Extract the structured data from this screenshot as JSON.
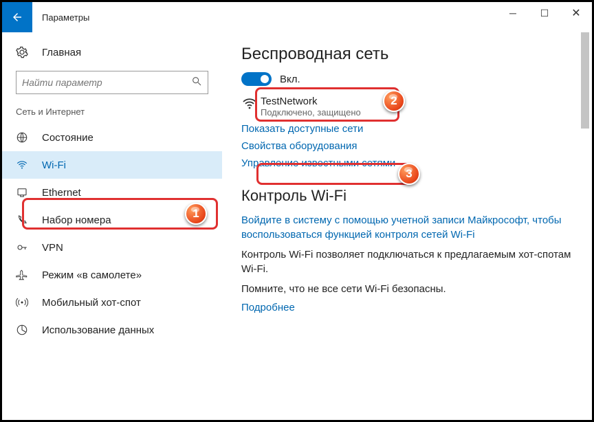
{
  "titlebar": {
    "title": "Параметры"
  },
  "sidebar": {
    "home": "Главная",
    "search_placeholder": "Найти параметр",
    "section": "Сеть и Интернет",
    "items": [
      {
        "label": "Состояние"
      },
      {
        "label": "Wi-Fi"
      },
      {
        "label": "Ethernet"
      },
      {
        "label": "Набор номера"
      },
      {
        "label": "VPN"
      },
      {
        "label": "Режим «в самолете»"
      },
      {
        "label": "Мобильный хот-спот"
      },
      {
        "label": "Использование данных"
      }
    ]
  },
  "content": {
    "heading1": "Беспроводная сеть",
    "toggle_label": "Вкл.",
    "network": {
      "name": "TestNetwork",
      "status": "Подключено, защищено"
    },
    "link_available": "Показать доступные сети",
    "link_hardware": "Свойства оборудования",
    "link_known": "Управление известными сетями",
    "heading2": "Контроль Wi-Fi",
    "link_signin": "Войдите в систему с помощью учетной записи Майкрософт, чтобы воспользоваться функцией контроля сетей Wi-Fi",
    "body1": "Контроль Wi-Fi позволяет подключаться к предлагаемым хот-спотам Wi-Fi.",
    "body2": "Помните, что не все сети Wi-Fi безопасны.",
    "link_more": "Подробнее"
  },
  "badges": {
    "b1": "1",
    "b2": "2",
    "b3": "3"
  }
}
